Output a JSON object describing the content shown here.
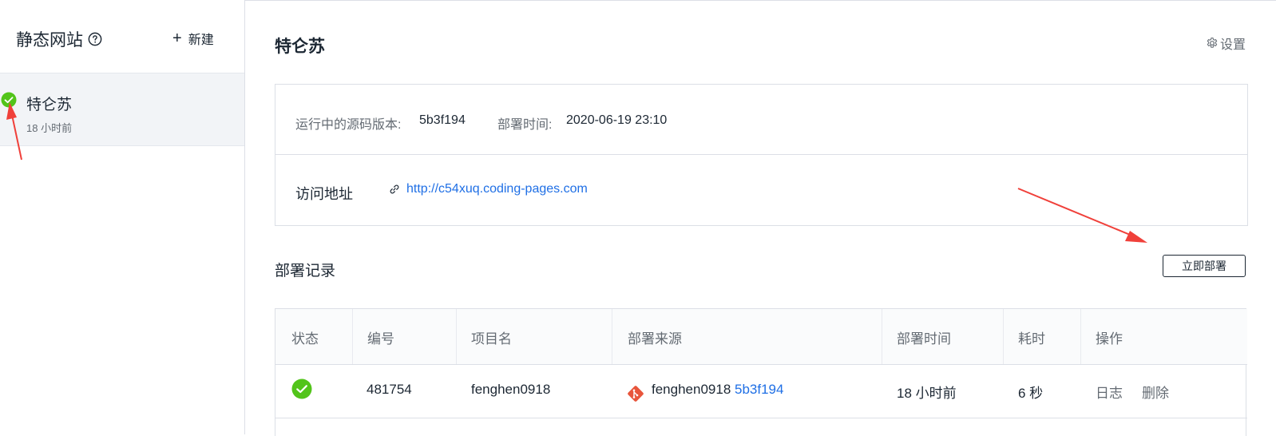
{
  "sidebar": {
    "title": "静态网站",
    "new_label": "新建",
    "sites": [
      {
        "name": "特仑苏",
        "time": "18 小时前",
        "status": "success"
      }
    ]
  },
  "main": {
    "title": "特仑苏",
    "settings_label": "设置",
    "info": {
      "version_label": "运行中的源码版本:",
      "version_value": "5b3f194",
      "deploy_time_label": "部署时间:",
      "deploy_time_value": "2020-06-19 23:10",
      "address_label": "访问地址",
      "address_url": "http://c54xuq.coding-pages.com"
    },
    "records": {
      "title": "部署记录",
      "deploy_now_label": "立即部署",
      "columns": [
        "状态",
        "编号",
        "项目名",
        "部署来源",
        "部署时间",
        "耗时",
        "操作"
      ],
      "rows": [
        {
          "status": "success",
          "id": "481754",
          "project": "fenghen0918",
          "source_repo": "fenghen0918",
          "source_commit": "5b3f194",
          "time": "18 小时前",
          "duration": "6 秒",
          "op_log": "日志",
          "op_delete": "删除"
        }
      ]
    }
  },
  "colors": {
    "success": "#52c41a",
    "link": "#1f6fe5",
    "annotation_arrow": "#f0403a",
    "git": "#e8553b"
  },
  "icons": [
    "help-icon",
    "plus-icon",
    "check-circle-icon",
    "gear-icon",
    "link-icon",
    "git-icon"
  ]
}
